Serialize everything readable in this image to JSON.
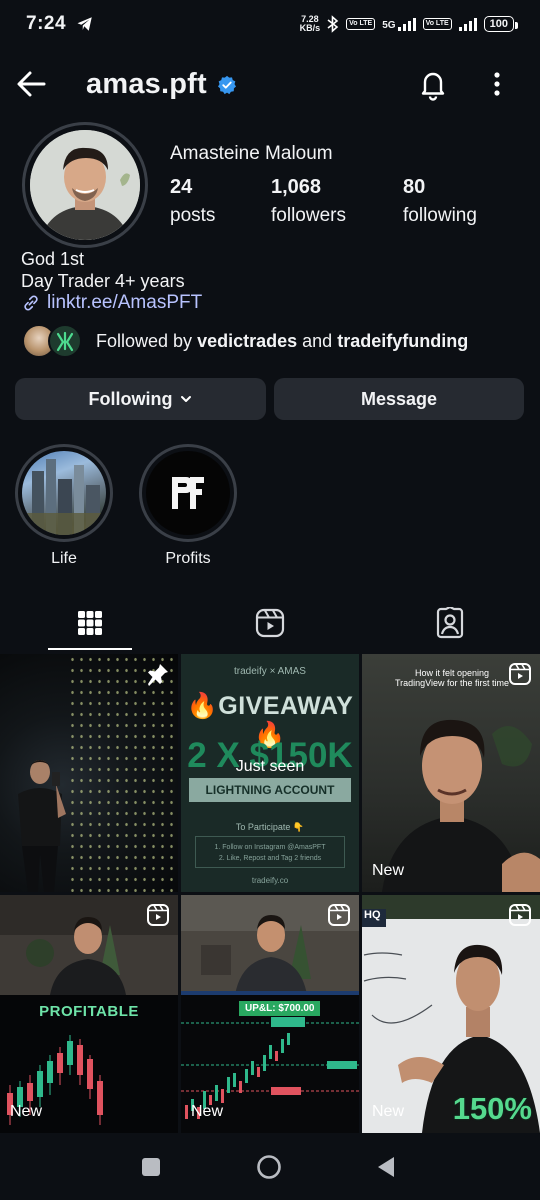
{
  "status_bar": {
    "time": "7:24",
    "net_speed_value": "7.28",
    "net_speed_unit": "KB/s",
    "network": "5G",
    "volte_label": "Vo LTE",
    "battery": "100"
  },
  "header": {
    "username": "amas.pft",
    "verified": true
  },
  "profile": {
    "full_name": "Amasteine Maloum",
    "stats": [
      {
        "value": "24",
        "label": "posts"
      },
      {
        "value": "1,068",
        "label": "followers"
      },
      {
        "value": "80",
        "label": "following"
      }
    ],
    "bio_lines": [
      "God 1st",
      "Day Trader 4+ years"
    ],
    "link": "linktr.ee/AmasPFT",
    "followed_by": {
      "prefix": "Followed by",
      "user1": "vedictrades",
      "conj": "and",
      "user2": "tradeifyfunding"
    }
  },
  "actions": {
    "following_label": "Following",
    "message_label": "Message"
  },
  "highlights": [
    {
      "label": "Life"
    },
    {
      "label": "Profits"
    }
  ],
  "tabs": [
    {
      "icon": "grid-icon",
      "active": true
    },
    {
      "icon": "reels-icon",
      "active": false
    },
    {
      "icon": "tagged-icon",
      "active": false
    }
  ],
  "grid": {
    "t1": {
      "pinned": true
    },
    "t2": {
      "brand": "tradeify  ×  AMAS",
      "headline": "🔥GIVEAWAY🔥",
      "amount": "2 X $150K",
      "seen_label": "Just seen",
      "account": "LIGHTNING ACCOUNT",
      "participate": "To Participate 👇",
      "steps": [
        "1. Follow on Instagram @AmasPFT",
        "2. Like, Repost and Tag 2 friends"
      ],
      "domain": "tradeify.co"
    },
    "t3": {
      "caption": "How it felt opening TradingView for the first time",
      "new_label": "New"
    },
    "t4": {
      "banner": "PROFITABLE",
      "new_label": "New"
    },
    "t5": {
      "banner": "UP&L: $700.00",
      "new_label": "New"
    },
    "t6": {
      "banner": "150%",
      "board_text": "HQ",
      "new_label": "New"
    }
  },
  "colors": {
    "background": "#0c0f14",
    "button": "#262a31",
    "link": "#b8c3ff",
    "verified": "#3797f0",
    "profit_green": "#55d98e"
  }
}
